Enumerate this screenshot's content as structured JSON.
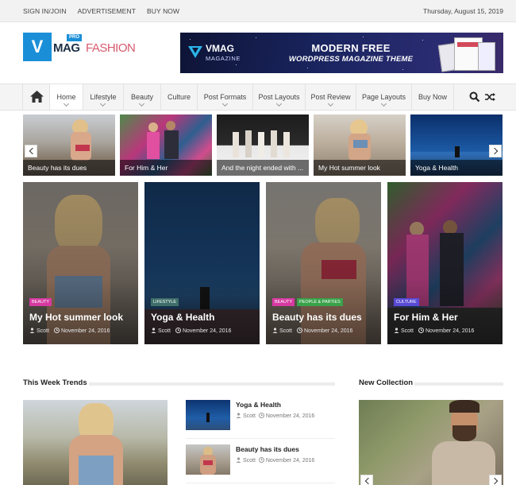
{
  "topbar": {
    "links": [
      "SIGN IN/JOIN",
      "ADVERTISEMENT",
      "BUY NOW"
    ],
    "date": "Thursday, August 15, 2019"
  },
  "logo": {
    "letter": "V",
    "badge": "PRO",
    "word1": "MAG",
    "word2": "FASHION",
    "brand_color": "#1a8fd8",
    "accent_color": "#d65a6e"
  },
  "banner": {
    "logo_text": "VMAG",
    "logo_sub": "MAGAZINE",
    "headline": "MODERN FREE",
    "subheadline": "WORDPRESS MAGAZINE THEME"
  },
  "nav": {
    "home_icon": "home-icon",
    "items": [
      {
        "label": "Home",
        "active": true,
        "dropdown": true
      },
      {
        "label": "Lifestyle",
        "active": false,
        "dropdown": true
      },
      {
        "label": "Beauty",
        "active": false,
        "dropdown": true
      },
      {
        "label": "Culture",
        "active": false,
        "dropdown": false
      },
      {
        "label": "Post Formats",
        "active": false,
        "dropdown": true
      },
      {
        "label": "Post Layouts",
        "active": false,
        "dropdown": true
      },
      {
        "label": "Post Review",
        "active": false,
        "dropdown": true
      },
      {
        "label": "Page Layouts",
        "active": false,
        "dropdown": true
      },
      {
        "label": "Buy Now",
        "active": false,
        "dropdown": false
      }
    ],
    "search_icon": "search-icon",
    "random_icon": "shuffle-icon"
  },
  "slider": {
    "items": [
      {
        "caption": "Beauty has its dues"
      },
      {
        "caption": "For Him & Her"
      },
      {
        "caption": "And the night ended with ..."
      },
      {
        "caption": "My Hot summer look"
      },
      {
        "caption": "Yoga & Health"
      }
    ]
  },
  "featured": [
    {
      "cats": [
        {
          "label": "BEAUTY",
          "color": "#d63aa0"
        }
      ],
      "title": "My Hot summer look",
      "author": "Scott",
      "date": "November 24, 2016"
    },
    {
      "cats": [
        {
          "label": "LIFESTYLE",
          "color": "#3e6f6a"
        }
      ],
      "title": "Yoga & Health",
      "author": "Scott",
      "date": "November 24, 2016"
    },
    {
      "cats": [
        {
          "label": "BEAUTY",
          "color": "#d63aa0"
        },
        {
          "label": "PEOPLE & PARTIES",
          "color": "#3aa24a"
        }
      ],
      "title": "Beauty has its dues",
      "author": "Scott",
      "date": "November 24, 2016"
    },
    {
      "cats": [
        {
          "label": "CULTURE",
          "color": "#5a4bd6"
        }
      ],
      "title": "For Him & Her",
      "author": "Scott",
      "date": "November 24, 2016"
    }
  ],
  "trends": {
    "title": "This Week Trends",
    "items": [
      {
        "title": "Yoga & Health",
        "author": "Scott",
        "date": "November 24, 2016"
      },
      {
        "title": "Beauty has its dues",
        "author": "Scott",
        "date": "November 24, 2016"
      }
    ]
  },
  "collection": {
    "title": "New Collection"
  }
}
